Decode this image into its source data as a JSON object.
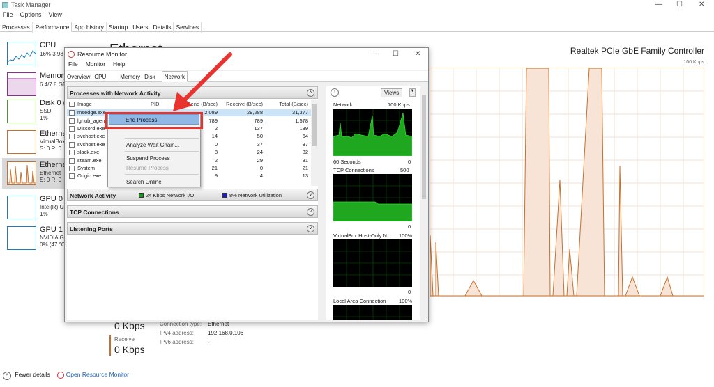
{
  "task_manager": {
    "title": "Task Manager",
    "menu": [
      "File",
      "Options",
      "View"
    ],
    "tabs": [
      "Processes",
      "Performance",
      "App history",
      "Startup",
      "Users",
      "Details",
      "Services"
    ],
    "active_tab": "Performance",
    "sidebar": [
      {
        "name": "CPU",
        "sub1": "16% 3.98",
        "sub2": ""
      },
      {
        "name": "Memory",
        "sub1": "6.4/7.8 GB",
        "sub2": ""
      },
      {
        "name": "Disk 0 (C:)",
        "sub1": "SSD",
        "sub2": "1%"
      },
      {
        "name": "Ethernet",
        "sub1": "VirtualBox",
        "sub2": "S: 0 R: 0"
      },
      {
        "name": "Ethernet",
        "sub1": "Ethernet",
        "sub2": "S: 0 R: 0"
      },
      {
        "name": "GPU 0",
        "sub1": "Intel(R) UH",
        "sub2": "1%"
      },
      {
        "name": "GPU 1",
        "sub1": "NVIDIA G",
        "sub2": "0% (47 °C)"
      }
    ],
    "main_title": "Ethernet",
    "adapter": "Realtek PCIe GbE Family Controller",
    "scale_max": "100 Kbps",
    "send_value": "0 Kbps",
    "receive_label": "Receive",
    "receive_value": "0 Kbps",
    "details": [
      {
        "label": "Connection type:",
        "value": "Ethernet"
      },
      {
        "label": "IPv4 address:",
        "value": "192.168.0.106"
      },
      {
        "label": "IPv6 address:",
        "value": "-"
      }
    ],
    "footer": {
      "fewer_details": "Fewer details",
      "open_rm": "Open Resource Monitor"
    }
  },
  "colors": {
    "ethernet": "#c8702a",
    "cpu": "#1a7cc0",
    "memory": "#8b2d8b",
    "disk": "#4a9a1e",
    "gpu": "#1a7cc0",
    "highlight_red": "#e8332f"
  },
  "resource_monitor": {
    "title": "Resource Monitor",
    "menu": [
      "File",
      "Monitor",
      "Help"
    ],
    "tabs": [
      "Overview",
      "CPU",
      "Memory",
      "Disk",
      "Network"
    ],
    "active_tab": "Network",
    "sections": {
      "processes": "Processes with Network Activity",
      "network_activity": "Network Activity",
      "net_io": "24 Kbps Network I/O",
      "net_util": "8% Network Utilization",
      "tcp": "TCP Connections",
      "listening": "Listening Ports"
    },
    "columns": [
      "Image",
      "PID",
      "Send (B/sec)",
      "Receive (B/sec)",
      "Total (B/sec)"
    ],
    "rows": [
      {
        "image": "msedge.exe",
        "pid": "",
        "send": "2,089",
        "receive": "29,288",
        "total": "31,377"
      },
      {
        "image": "lghub_agent.exe",
        "pid": "",
        "send": "789",
        "receive": "789",
        "total": "1,578"
      },
      {
        "image": "Discord.exe",
        "pid": "",
        "send": "2",
        "receive": "137",
        "total": "139"
      },
      {
        "image": "svchost.exe (Net",
        "pid": "",
        "send": "14",
        "receive": "50",
        "total": "64"
      },
      {
        "image": "svchost.exe (Loc",
        "pid": "",
        "send": "0",
        "receive": "37",
        "total": "37"
      },
      {
        "image": "slack.exe",
        "pid": "",
        "send": "8",
        "receive": "24",
        "total": "32"
      },
      {
        "image": "steam.exe",
        "pid": "",
        "send": "2",
        "receive": "29",
        "total": "31"
      },
      {
        "image": "System",
        "pid": "",
        "send": "21",
        "receive": "0",
        "total": "21"
      },
      {
        "image": "Origin.exe",
        "pid": "",
        "send": "9",
        "receive": "4",
        "total": "13"
      }
    ],
    "context_menu": [
      {
        "label": "End Process",
        "disabled": false
      },
      {
        "label": "Analyze Wait Chain...",
        "disabled": false
      },
      {
        "label": "Suspend Process",
        "disabled": false
      },
      {
        "label": "Resume Process",
        "disabled": true
      },
      {
        "label": "Search Online",
        "disabled": false
      }
    ],
    "views_label": "Views",
    "graphs": [
      {
        "label": "Network",
        "max": "100 Kbps",
        "footer_left": "60 Seconds",
        "footer_right": "0"
      },
      {
        "label": "TCP Connections",
        "max": "500",
        "footer_left": "",
        "footer_right": "0"
      },
      {
        "label": "VirtualBox Host-Only N...",
        "max": "100%",
        "footer_left": "",
        "footer_right": "0"
      },
      {
        "label": "Local Area Connection",
        "max": "100%",
        "footer_left": "",
        "footer_right": ""
      }
    ]
  }
}
